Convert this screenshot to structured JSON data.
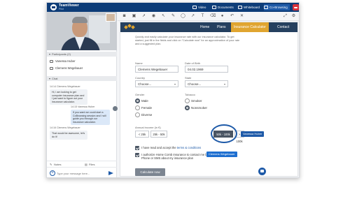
{
  "app": {
    "brand": "TeamViewer",
    "sub": "Pilot"
  },
  "titlebar_tabs": {
    "video": "Video",
    "documents": "Documents",
    "whiteboard": "Whiteboard",
    "cobrowsing": "Co-Browsing"
  },
  "left": {
    "participants_header": "Participants (2)",
    "participants": [
      "Vanessa Huber",
      "Clemens Wegebauer"
    ],
    "chat_header": "Chat",
    "messages": [
      {
        "meta": "14:14 Clemens Wegebauer",
        "text": "Hi, I am looking to get computer insurance plan and I just want to figure out your insurance calculator."
      },
      {
        "meta": "14:15 Vanessa Huber",
        "text": "If you want we could start a CoBrowsing session and I will guide you through our insurance calculator."
      },
      {
        "meta": "14:16 Clemens Wegebauer",
        "text": "That would be awesome, let's do it!"
      }
    ],
    "tool_notes": "Notes",
    "tool_files": "Files",
    "input_placeholder": "Type your message here..."
  },
  "site": {
    "nav": {
      "home": "Home",
      "plans": "Plans",
      "calculator": "Insurance Calculator",
      "contact": "Contact"
    },
    "intro": "Quickly and easily calculate your insurance rate with our insurance calculator. To get started, just fill in the fields and click on \"Calculate now\" for an approximation of your rate and a suggested plan.",
    "name_label": "Name",
    "name_value": "Clemens Wegebauer",
    "dob_label": "Date of Birth",
    "dob_value": "04.02.1969",
    "country_label": "Country",
    "country_value": "Choose...",
    "state_label": "State",
    "state_value": "Choose...",
    "gender_label": "Gender",
    "gender_male": "Male",
    "gender_female": "Female",
    "gender_diverse": "Diverse",
    "tobacco_label": "Tobacco",
    "tobacco_smoker": "Smoker",
    "tobacco_nonsmoker": "Nonsmoker",
    "income_label": "Annual income (in €)",
    "income_options": [
      "< 25k",
      "25k - 50k",
      "50k - 100k",
      "> 100k"
    ],
    "cursor_vanessa": "Vanessa Huber",
    "cursor_clemens": "Clemens Wegebauer",
    "terms_text": "I have read and accept the ",
    "terms_link": "terms & conditions",
    "authorize_text": "I authorize Home Comb Insurance to contact me by Phone or SMS about my insurance plan",
    "submit": "Calculate now"
  }
}
